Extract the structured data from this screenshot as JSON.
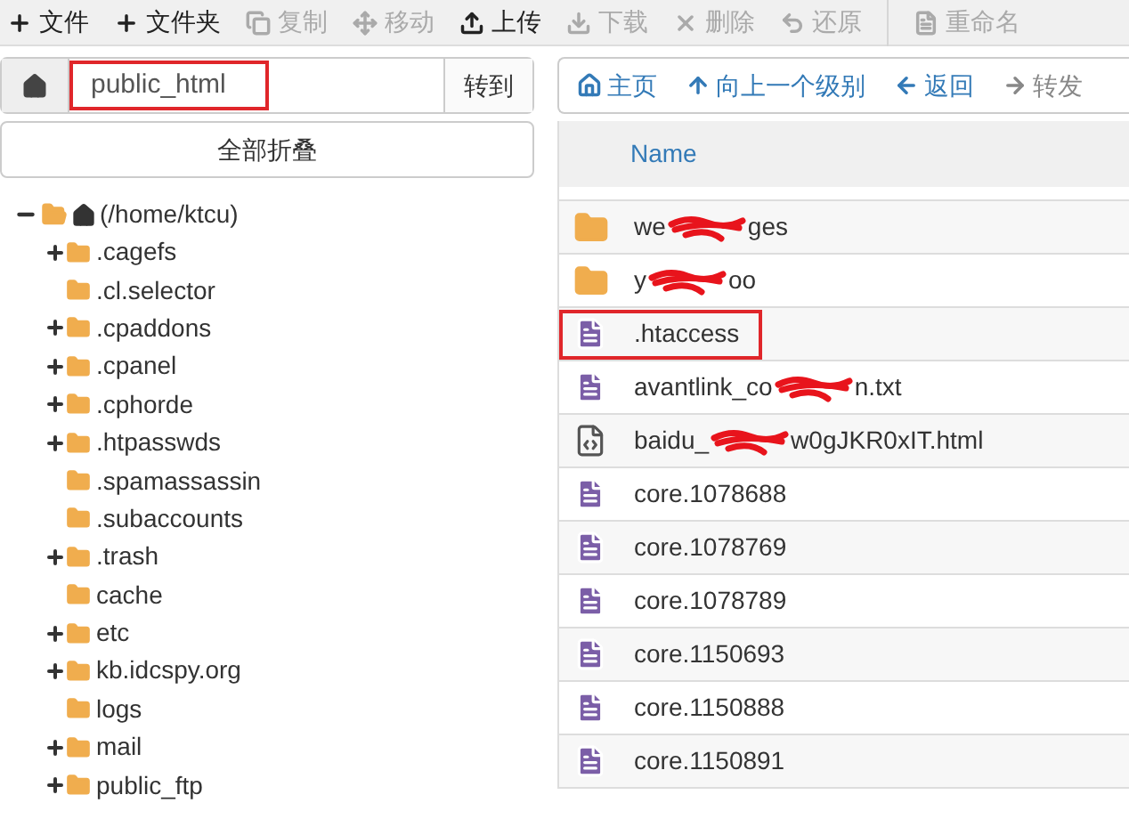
{
  "toolbar": [
    {
      "label": "文件",
      "disabled": false
    },
    {
      "label": "文件夹",
      "disabled": false
    },
    {
      "label": "复制",
      "disabled": true
    },
    {
      "label": "移动",
      "disabled": true
    },
    {
      "label": "上传",
      "disabled": false
    },
    {
      "label": "下载",
      "disabled": true
    },
    {
      "label": "删除",
      "disabled": true
    },
    {
      "label": "还原",
      "disabled": true
    },
    {
      "label": "重命名",
      "disabled": true
    }
  ],
  "path_bar": {
    "value": "public_html",
    "highlighted": true,
    "go_button": "转到"
  },
  "collapse_all_button": "全部折叠",
  "tree": {
    "label": "(/home/ktcu)",
    "expanded": true,
    "children": [
      {
        "label": ".cagefs",
        "expandable": true
      },
      {
        "label": ".cl.selector",
        "expandable": false
      },
      {
        "label": ".cpaddons",
        "expandable": true
      },
      {
        "label": ".cpanel",
        "expandable": true
      },
      {
        "label": ".cphorde",
        "expandable": true
      },
      {
        "label": ".htpasswds",
        "expandable": true
      },
      {
        "label": ".spamassassin",
        "expandable": false
      },
      {
        "label": ".subaccounts",
        "expandable": false
      },
      {
        "label": ".trash",
        "expandable": true
      },
      {
        "label": "cache",
        "expandable": false
      },
      {
        "label": "etc",
        "expandable": true
      },
      {
        "label": "kb.idcspy.org",
        "expandable": true
      },
      {
        "label": "logs",
        "expandable": false
      },
      {
        "label": "mail",
        "expandable": true
      },
      {
        "label": "public_ftp",
        "expandable": true
      }
    ]
  },
  "nav": [
    {
      "label": "主页",
      "disabled": false
    },
    {
      "label": "向上一个级别",
      "disabled": false
    },
    {
      "label": "返回",
      "disabled": false
    },
    {
      "label": "转发",
      "disabled": true
    }
  ],
  "table": {
    "columns": [
      "Name"
    ],
    "rows": [
      {
        "kind": "folder",
        "name": "we",
        "name_end": "ges",
        "redacted": true,
        "highlighted": false
      },
      {
        "kind": "folder",
        "name": "y",
        "name_end": "oo",
        "redacted": true,
        "highlighted": false
      },
      {
        "kind": "text",
        "name": ".htaccess",
        "redacted": false,
        "highlighted": true
      },
      {
        "kind": "text",
        "name": "avantlink_co",
        "name_end": "n.txt",
        "redacted": true,
        "highlighted": false
      },
      {
        "kind": "code",
        "name": "baidu_",
        "name_end": "w0gJKR0xIT.html",
        "redacted": true,
        "highlighted": false
      },
      {
        "kind": "text",
        "name": "core.1078688",
        "redacted": false,
        "highlighted": false
      },
      {
        "kind": "text",
        "name": "core.1078769",
        "redacted": false,
        "highlighted": false
      },
      {
        "kind": "text",
        "name": "core.1078789",
        "redacted": false,
        "highlighted": false
      },
      {
        "kind": "text",
        "name": "core.1150693",
        "redacted": false,
        "highlighted": false
      },
      {
        "kind": "text",
        "name": "core.1150888",
        "redacted": false,
        "highlighted": false
      },
      {
        "kind": "text",
        "name": "core.1150891",
        "redacted": false,
        "highlighted": false
      }
    ]
  }
}
